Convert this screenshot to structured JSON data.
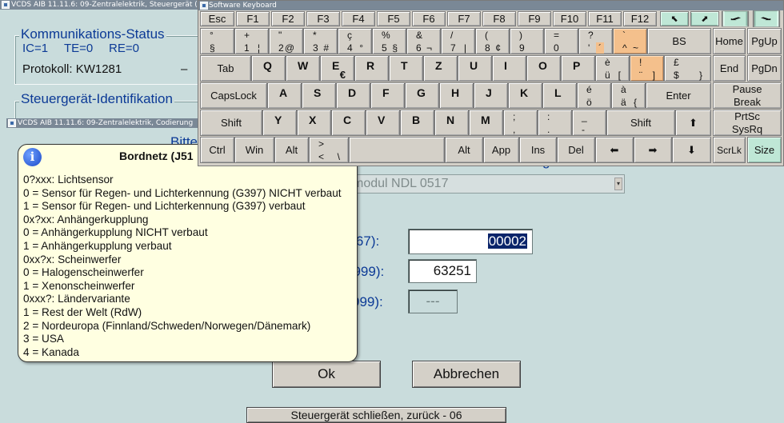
{
  "main_window": {
    "title": "VCDS AIB 11.11.6: 09-Zentralelektrik,  Steuergerät (AIB\\",
    "comm_status": {
      "heading": "Kommunikations-Status",
      "ic": "IC=1",
      "te": "TE=0",
      "re": "RE=0",
      "protocol_label": "Protokoll: KW1281",
      "dash": "–"
    },
    "ident_heading": "Steuergerät-Identifikation"
  },
  "coding_window": {
    "title": "VCDS AIB 11.11.6: 09-Zentralelektrik, Codierung",
    "partial_label": "Bitte",
    "partial_label2": "g",
    "combo_value": "modul  NDL 0517",
    "fields": [
      {
        "label": "2767):",
        "value": "00002"
      },
      {
        "label": "9999):",
        "value": "63251"
      },
      {
        "label": "999):",
        "value": "---"
      }
    ],
    "ok_label": "Ok",
    "cancel_label": "Abbrechen",
    "bottom_partial": "Steuergerät schließen, zurück - 06"
  },
  "tooltip": {
    "icon": "i",
    "title": "Bordnetz (J51",
    "lines": [
      "0?xxx: Lichtsensor",
      "0 = Sensor für Regen- und Lichterkennung (G397) NICHT verbaut",
      "1 = Sensor für Regen- und Lichterkennung (G397) verbaut",
      "0x?xx: Anhängerkupplung",
      "0 = Anhängerkupplung NICHT verbaut",
      "1 = Anhängerkupplung verbaut",
      "0xx?x: Scheinwerfer",
      "0 = Halogenscheinwerfer",
      "1 = Xenonscheinwerfer",
      "0xxx?: Ländervariante",
      "1 = Rest der Welt (RdW)",
      "2 = Nordeuropa (Finnland/Schweden/Norwegen/Dänemark)",
      "3 = USA",
      "4 = Kanada"
    ]
  },
  "keyboard": {
    "title": "Software Keyboard",
    "fn_row": [
      "Esc",
      "F1",
      "F2",
      "F3",
      "F4",
      "F5",
      "F6",
      "F7",
      "F8",
      "F9",
      "F10",
      "F11",
      "F12"
    ],
    "arrow_glyph": "⬉",
    "row1": [
      {
        "s": "°",
        "l": "§",
        "a": ""
      },
      {
        "s": "+",
        "l": "1",
        "a": "¦"
      },
      {
        "s": "\"",
        "l": "2",
        "a": "@"
      },
      {
        "s": "*",
        "l": "3",
        "a": "#"
      },
      {
        "s": "ç",
        "l": "4",
        "a": "°"
      },
      {
        "s": "%",
        "l": "5",
        "a": "§"
      },
      {
        "s": "&",
        "l": "6",
        "a": "¬"
      },
      {
        "s": "/",
        "l": "7",
        "a": "|"
      },
      {
        "s": "(",
        "l": "8",
        "a": "¢"
      },
      {
        "s": ")",
        "l": "9",
        "a": ""
      },
      {
        "s": "=",
        "l": "0",
        "a": ""
      },
      {
        "s": "?",
        "l": "'",
        "a": "´"
      },
      {
        "s": "`",
        "l": "^",
        "a": "~"
      }
    ],
    "bs": "BS",
    "home": "Home",
    "pgup": "PgUp",
    "tab": "Tab",
    "row2": [
      "Q",
      "W",
      "E",
      "R",
      "T",
      "Z",
      "U",
      "I",
      "O",
      "P"
    ],
    "e_alt": "€",
    "row2_sym": [
      {
        "s": "è",
        "l": "ü",
        "a": "["
      },
      {
        "s": "!",
        "l": "¨",
        "a": "]"
      },
      {
        "s": "£",
        "l": "$",
        "a": "}"
      }
    ],
    "end": "End",
    "pgdn": "PgDn",
    "capslock": "CapsLock",
    "row3": [
      "A",
      "S",
      "D",
      "F",
      "G",
      "H",
      "J",
      "K",
      "L"
    ],
    "row3_sym": [
      {
        "s": "é",
        "l": "ö",
        "a": ""
      },
      {
        "s": "à",
        "l": "ä",
        "a": "{"
      }
    ],
    "enter": "Enter",
    "pause": "Pause",
    "break": "Break",
    "shift": "Shift",
    "row4": [
      "Y",
      "X",
      "C",
      "V",
      "B",
      "N",
      "M"
    ],
    "row4_sym": [
      {
        "s": ";",
        "l": ","
      },
      {
        "s": ":",
        "l": "."
      },
      {
        "s": "_",
        "l": "-"
      }
    ],
    "up": "⬆",
    "prtsc": "PrtSc",
    "sysrq": "SysRq",
    "ctrl": "Ctrl",
    "win": "Win",
    "alt": "Alt",
    "lt_s": ">",
    "lt_l": "<",
    "lt_a": "\\",
    "altgr": "Alt",
    "app": "App",
    "ins": "Ins",
    "del": "Del",
    "left": "⬅",
    "right": "➡",
    "down": "⬇",
    "scrlk": "ScrLk",
    "size": "Size"
  }
}
